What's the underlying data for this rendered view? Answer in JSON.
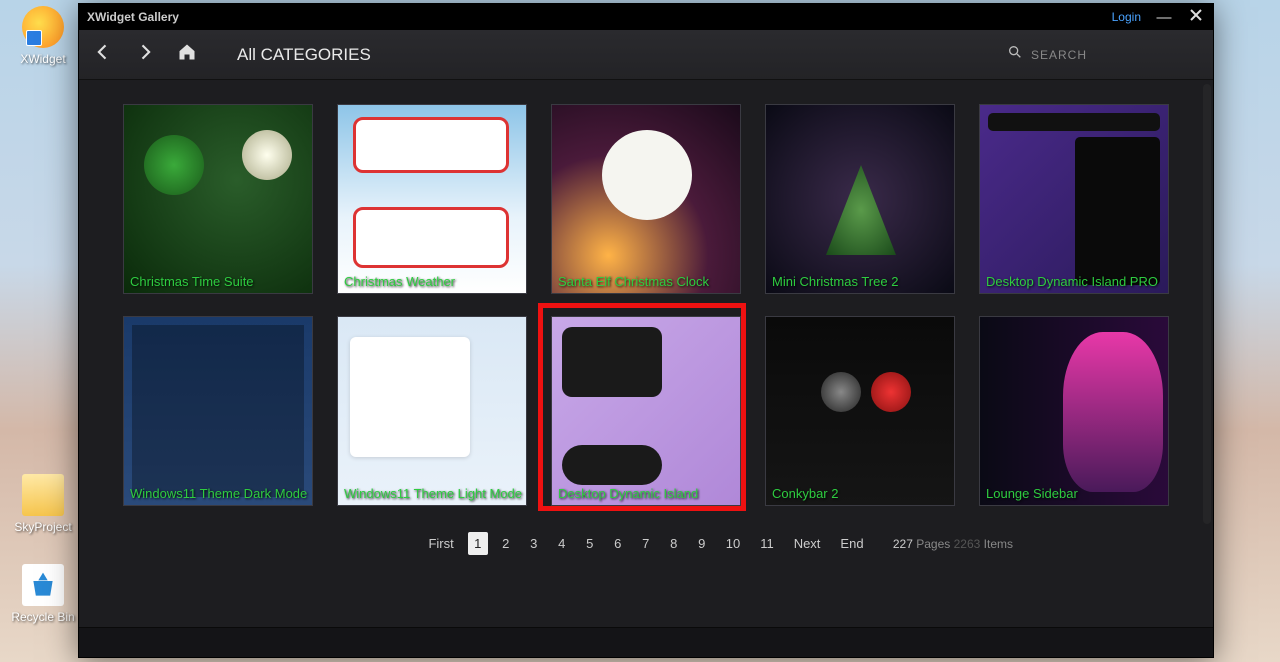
{
  "desktop_icons": {
    "xwidget": "XWidget",
    "skyproject": "SkyProject",
    "recyclebin": "Recycle Bin"
  },
  "window": {
    "title": "XWidget Gallery",
    "login": "Login"
  },
  "toolbar": {
    "breadcrumb": "All CATEGORIES",
    "search_placeholder": "SEARCH"
  },
  "gallery": [
    {
      "label": "Christmas Time Suite"
    },
    {
      "label": "Christmas Weather"
    },
    {
      "label": "Santa Elf Christmas Clock"
    },
    {
      "label": "Mini Christmas Tree 2"
    },
    {
      "label": "Desktop Dynamic Island PRO"
    },
    {
      "label": "Windows11 Theme Dark Mode"
    },
    {
      "label": "Windows11 Theme Light Mode"
    },
    {
      "label": "Desktop Dynamic Island"
    },
    {
      "label": "Conkybar 2"
    },
    {
      "label": "Lounge Sidebar"
    }
  ],
  "pagination": {
    "first": "First",
    "pages": [
      "1",
      "2",
      "3",
      "4",
      "5",
      "6",
      "7",
      "8",
      "9",
      "10",
      "11"
    ],
    "next": "Next",
    "end": "End",
    "current": "1",
    "total_pages": "227",
    "total_items": "2263",
    "pages_label": "Pages",
    "items_label": "Items"
  },
  "highlighted_index": 7
}
